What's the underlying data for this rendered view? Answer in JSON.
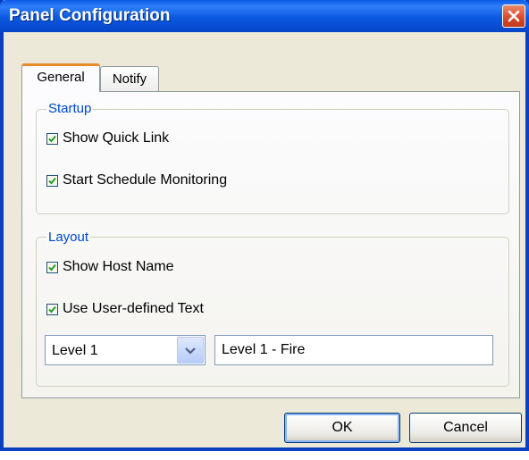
{
  "window": {
    "title": "Panel Configuration"
  },
  "tabs": [
    {
      "label": "General",
      "active": true
    },
    {
      "label": "Notify",
      "active": false
    }
  ],
  "startup": {
    "legend": "Startup",
    "show_quick_link": {
      "label": "Show Quick Link",
      "checked": true
    },
    "start_schedule_monitoring": {
      "label": "Start Schedule Monitoring",
      "checked": true
    }
  },
  "layout": {
    "legend": "Layout",
    "show_host_name": {
      "label": "Show Host Name",
      "checked": true
    },
    "use_user_defined_text": {
      "label": "Use User-defined Text",
      "checked": true
    },
    "level_select": {
      "value": "Level 1"
    },
    "level_text": {
      "value": "Level 1 - Fire"
    }
  },
  "buttons": {
    "ok": "OK",
    "cancel": "Cancel"
  },
  "colors": {
    "titlebar": "#0a58e0",
    "group_legend": "#0046d5",
    "checkmark": "#21a121",
    "active_tab_accent": "#e68b2c",
    "close_button": "#d7492a"
  },
  "icons": {
    "close": "close-icon",
    "checkmark": "checkmark-icon",
    "dropdown": "chevron-down-icon"
  }
}
